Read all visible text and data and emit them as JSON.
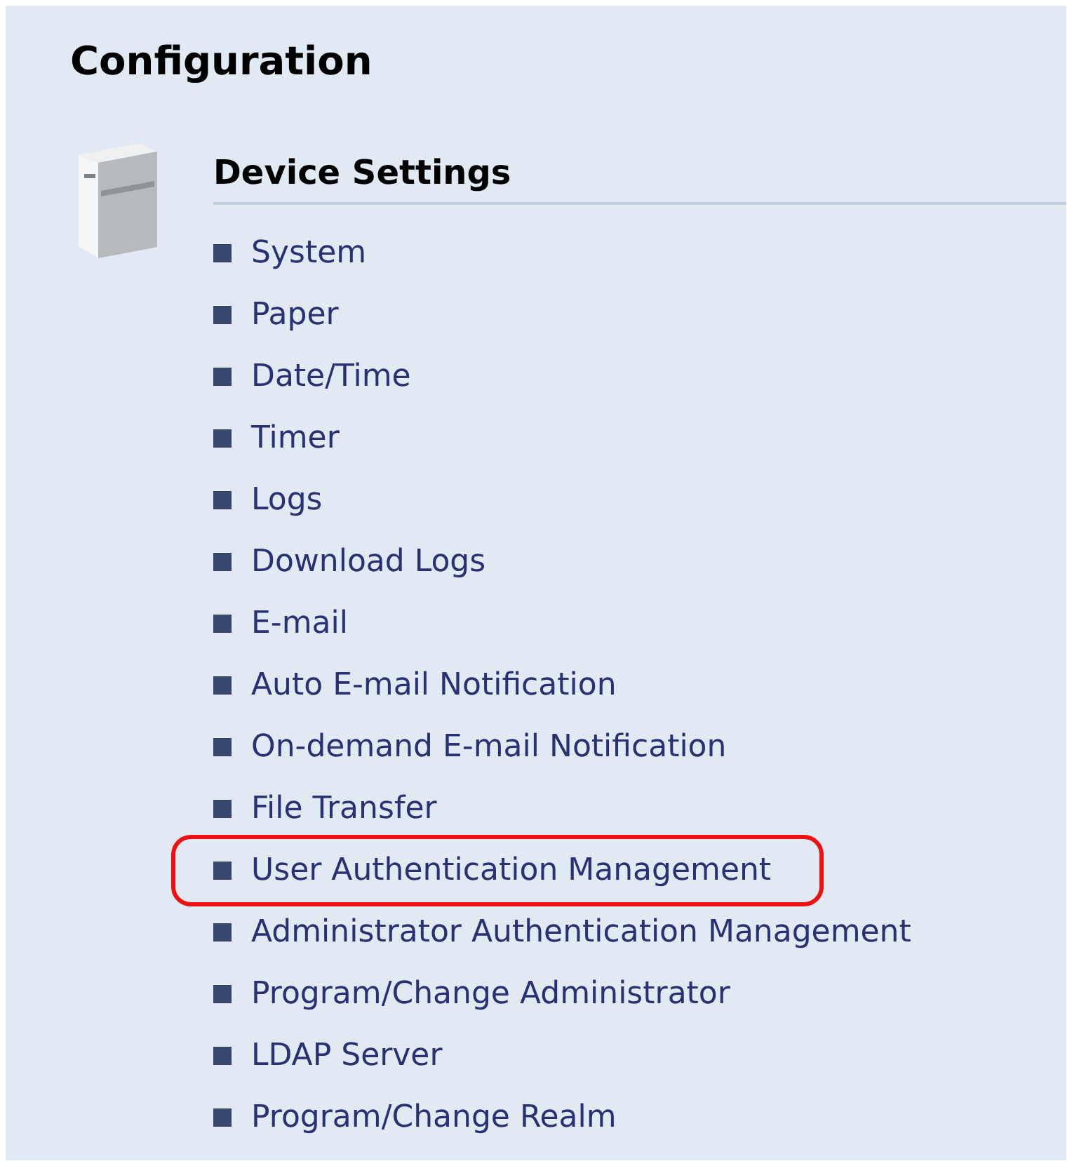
{
  "title": "Configuration",
  "section": {
    "title": "Device Settings",
    "items": [
      {
        "label": "System",
        "highlighted": false
      },
      {
        "label": "Paper",
        "highlighted": false
      },
      {
        "label": "Date/Time",
        "highlighted": false
      },
      {
        "label": "Timer",
        "highlighted": false
      },
      {
        "label": "Logs",
        "highlighted": false
      },
      {
        "label": "Download Logs",
        "highlighted": false
      },
      {
        "label": "E-mail",
        "highlighted": false
      },
      {
        "label": "Auto E-mail Notification",
        "highlighted": false
      },
      {
        "label": "On-demand E-mail Notification",
        "highlighted": false
      },
      {
        "label": "File Transfer",
        "highlighted": false
      },
      {
        "label": "User Authentication Management",
        "highlighted": true
      },
      {
        "label": "Administrator Authentication Management",
        "highlighted": false
      },
      {
        "label": "Program/Change Administrator",
        "highlighted": false
      },
      {
        "label": "LDAP Server",
        "highlighted": false
      },
      {
        "label": "Program/Change Realm",
        "highlighted": false
      }
    ]
  }
}
